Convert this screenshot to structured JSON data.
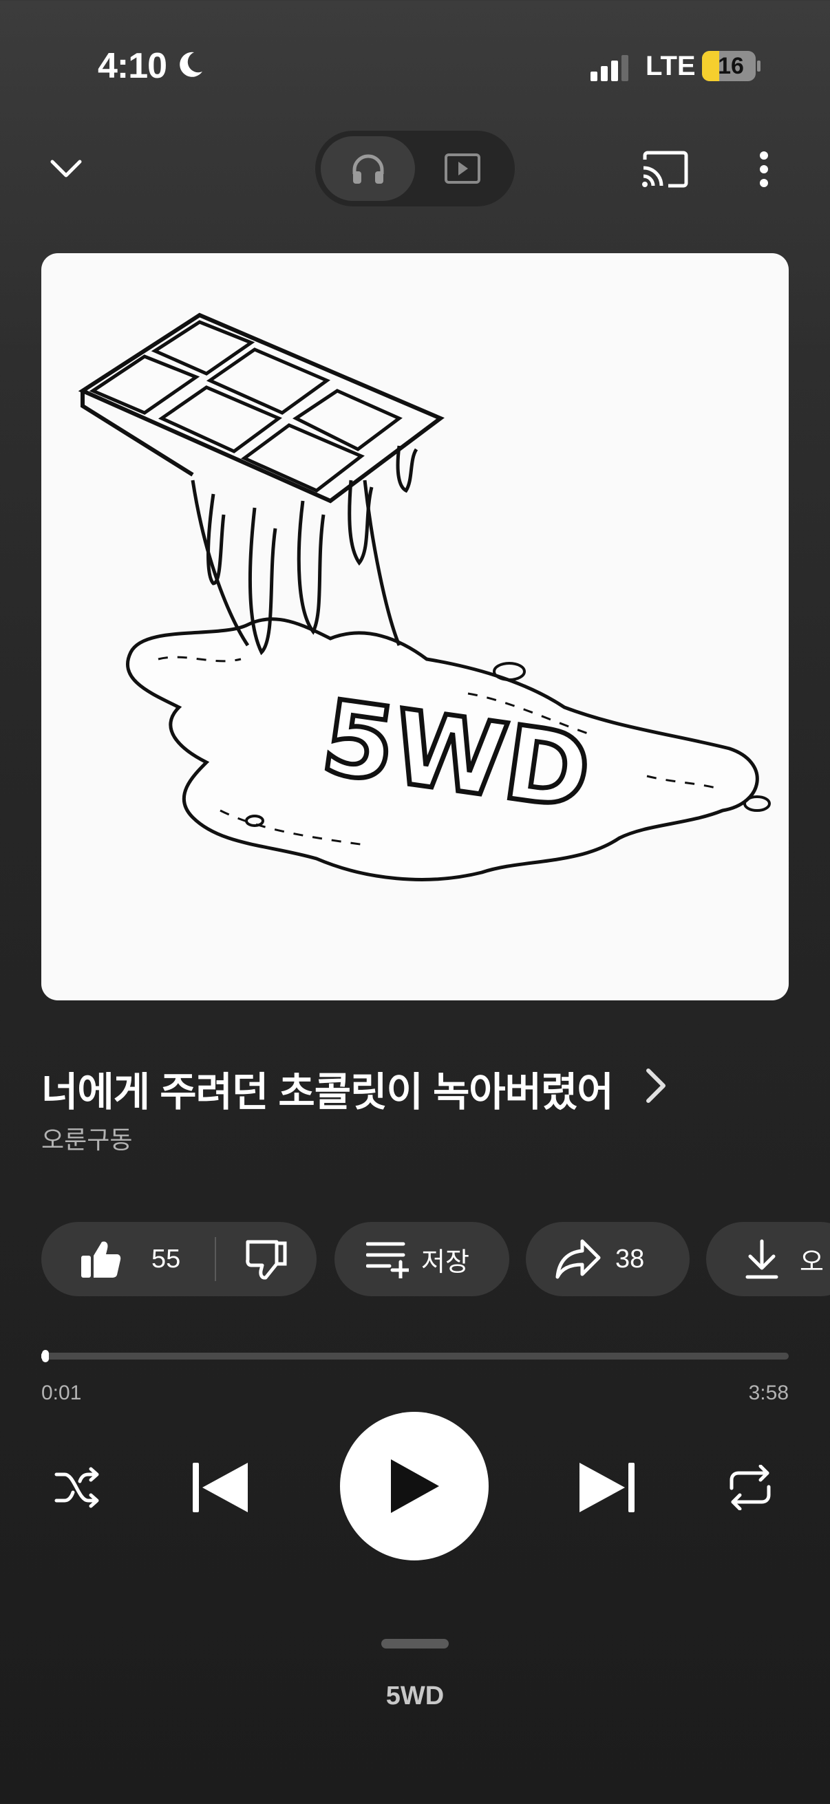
{
  "status_bar": {
    "time": "4:10",
    "network": "LTE",
    "battery": "16"
  },
  "top_bar": {
    "toggle_modes": [
      "audio",
      "video"
    ],
    "active_mode": "audio"
  },
  "album_art": {
    "text": "5WD"
  },
  "song": {
    "title": "너에게 주려던 초콜릿이 녹아버렸어",
    "artist": "오룬구동"
  },
  "actions": {
    "like_count": "55",
    "save_label": "저장",
    "share_count": "38",
    "download_label": "오"
  },
  "playback": {
    "current_time": "0:01",
    "total_time": "3:58",
    "progress": 0.004
  },
  "bottom": {
    "label": "5WD"
  },
  "colors": {
    "background": "#262626",
    "chip": "#383838",
    "accent": "#ffffff",
    "battery": "#f5cf2e"
  }
}
